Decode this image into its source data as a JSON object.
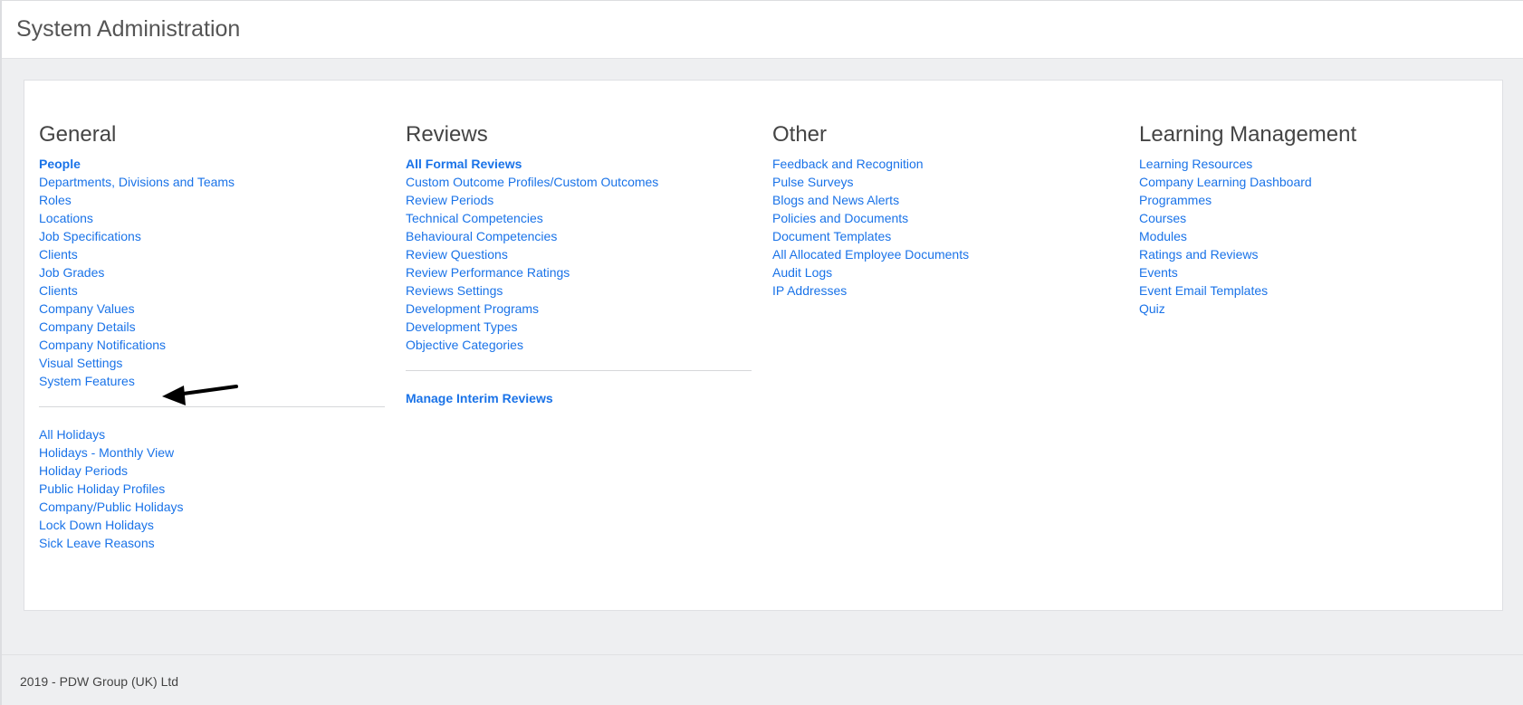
{
  "header": {
    "title": "System Administration"
  },
  "general": {
    "title": "General",
    "primary": [
      {
        "label": "People",
        "bold": true
      },
      {
        "label": "Departments, Divisions and Teams"
      },
      {
        "label": "Roles"
      },
      {
        "label": "Locations"
      },
      {
        "label": "Job Specifications"
      },
      {
        "label": "Clients"
      },
      {
        "label": "Job Grades"
      },
      {
        "label": "Clients"
      },
      {
        "label": "Company Values"
      },
      {
        "label": "Company Details"
      },
      {
        "label": "Company Notifications"
      },
      {
        "label": "Visual Settings"
      },
      {
        "label": "System Features"
      }
    ],
    "secondary": [
      {
        "label": "All Holidays"
      },
      {
        "label": "Holidays - Monthly View"
      },
      {
        "label": "Holiday Periods"
      },
      {
        "label": "Public Holiday Profiles"
      },
      {
        "label": "Company/Public Holidays"
      },
      {
        "label": "Lock Down Holidays"
      },
      {
        "label": "Sick Leave Reasons"
      }
    ]
  },
  "reviews": {
    "title": "Reviews",
    "primary": [
      {
        "label": "All Formal Reviews",
        "bold": true
      },
      {
        "label": "Custom Outcome Profiles/Custom Outcomes"
      },
      {
        "label": "Review Periods"
      },
      {
        "label": "Technical Competencies"
      },
      {
        "label": "Behavioural Competencies"
      },
      {
        "label": "Review Questions"
      },
      {
        "label": "Review Performance Ratings"
      },
      {
        "label": "Reviews Settings"
      },
      {
        "label": "Development Programs"
      },
      {
        "label": "Development Types"
      },
      {
        "label": "Objective Categories"
      }
    ],
    "secondary": [
      {
        "label": "Manage Interim Reviews",
        "bold": true
      }
    ]
  },
  "other": {
    "title": "Other",
    "primary": [
      {
        "label": "Feedback and Recognition"
      },
      {
        "label": "Pulse Surveys"
      },
      {
        "label": "Blogs and News Alerts"
      },
      {
        "label": "Policies and Documents"
      },
      {
        "label": "Document Templates"
      },
      {
        "label": "All Allocated Employee Documents"
      },
      {
        "label": "Audit Logs"
      },
      {
        "label": "IP Addresses"
      }
    ]
  },
  "learning": {
    "title": "Learning Management",
    "primary": [
      {
        "label": "Learning Resources"
      },
      {
        "label": "Company Learning Dashboard"
      },
      {
        "label": "Programmes"
      },
      {
        "label": "Courses"
      },
      {
        "label": "Modules"
      },
      {
        "label": "Ratings and Reviews"
      },
      {
        "label": "Events"
      },
      {
        "label": "Event Email Templates"
      },
      {
        "label": "Quiz"
      }
    ]
  },
  "annotation": {
    "icon": "arrow-left-icon",
    "color": "#000000"
  },
  "footer": {
    "text": "2019 - PDW Group (UK) Ltd"
  },
  "colors": {
    "link": "#1a73e8",
    "background": "#eeeff1",
    "card": "#ffffff"
  }
}
